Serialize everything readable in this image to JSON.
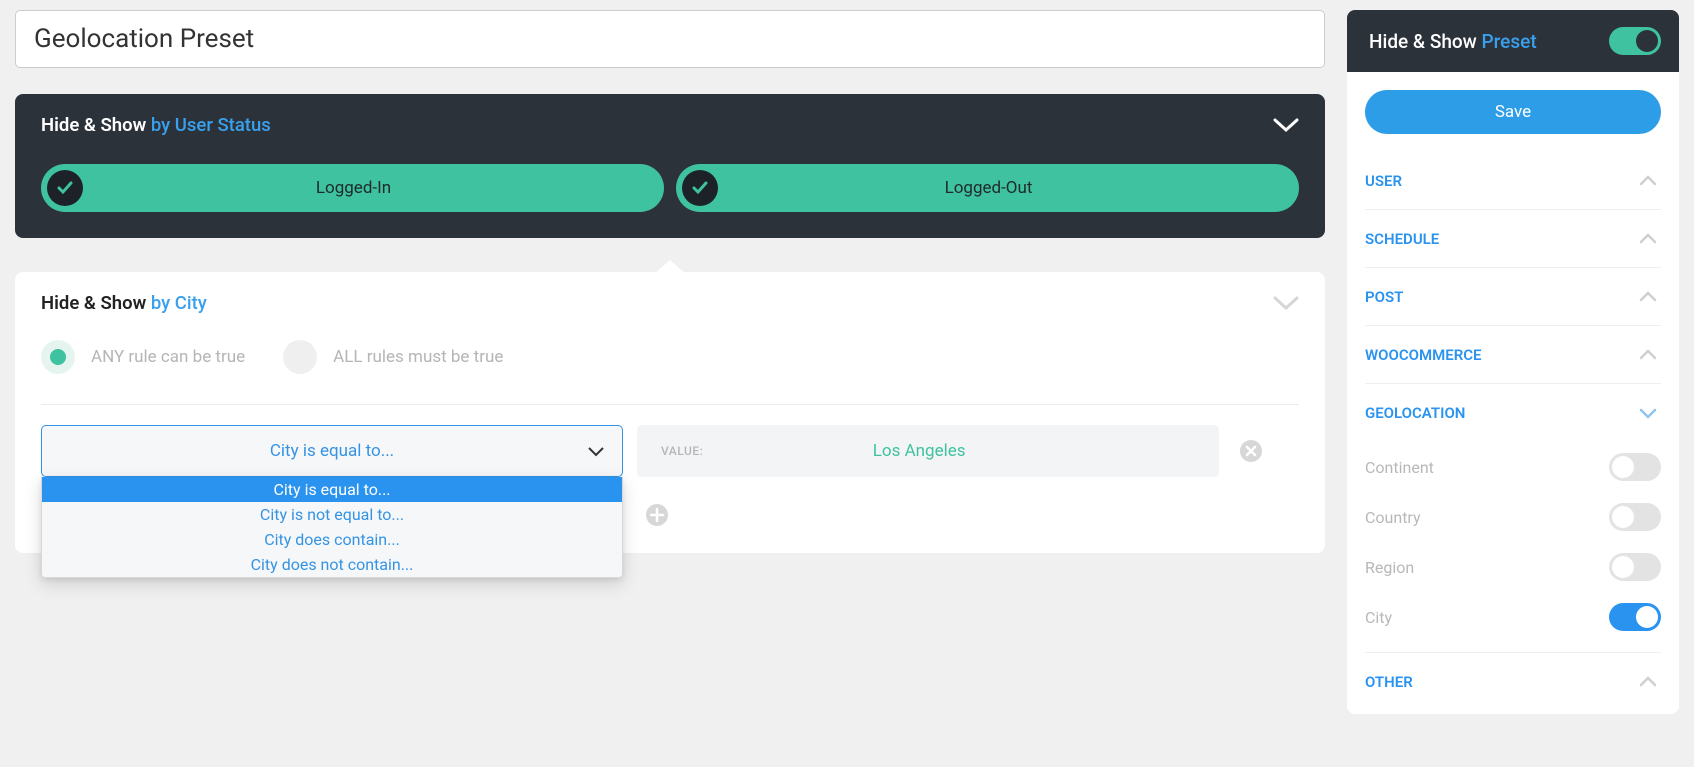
{
  "preset_name": "Geolocation Preset",
  "panels": {
    "user_status": {
      "title_prefix": "Hide & Show",
      "title_suffix": "by User Status",
      "pills": [
        "Logged-In",
        "Logged-Out"
      ]
    },
    "city": {
      "title_prefix": "Hide & Show",
      "title_suffix": "by City",
      "radio_any": "ANY rule can be true",
      "radio_all": "ALL rules must be true",
      "rule_select": "City is equal to...",
      "rule_options": [
        "City is equal to...",
        "City is not equal to...",
        "City does contain...",
        "City does not contain..."
      ],
      "value_label": "VALUE:",
      "value_text": "Los Angeles"
    }
  },
  "sidebar": {
    "title_prefix": "Hide & Show",
    "title_suffix": "Preset",
    "save": "Save",
    "categories": {
      "user": "USER",
      "schedule": "SCHEDULE",
      "post": "POST",
      "woocommerce": "WOOCOMMERCE",
      "geolocation": "GEOLOCATION",
      "other": "OTHER"
    },
    "geo_items": {
      "continent": "Continent",
      "country": "Country",
      "region": "Region",
      "city": "City"
    }
  }
}
